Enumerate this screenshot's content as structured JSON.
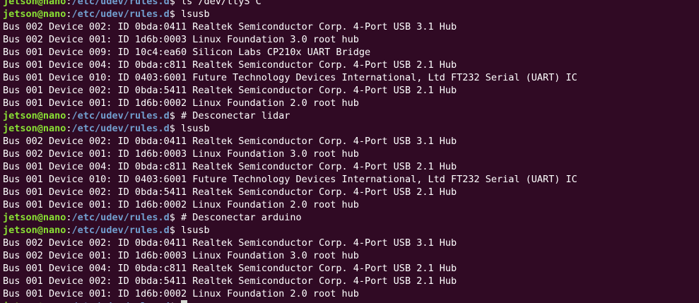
{
  "terminal": {
    "lines": [
      {
        "kind": "prompt",
        "user": "jetson@nano",
        "path": "/etc/udev/rules.d",
        "symbol": "$",
        "command": " ls /dev/ttyS C"
      },
      {
        "kind": "prompt",
        "user": "jetson@nano",
        "path": "/etc/udev/rules.d",
        "symbol": "$",
        "command": " lsusb"
      },
      {
        "kind": "output",
        "text": "Bus 002 Device 002: ID 0bda:0411 Realtek Semiconductor Corp. 4-Port USB 3.1 Hub"
      },
      {
        "kind": "output",
        "text": "Bus 002 Device 001: ID 1d6b:0003 Linux Foundation 3.0 root hub"
      },
      {
        "kind": "output",
        "text": "Bus 001 Device 009: ID 10c4:ea60 Silicon Labs CP210x UART Bridge"
      },
      {
        "kind": "output",
        "text": "Bus 001 Device 004: ID 0bda:c811 Realtek Semiconductor Corp. 4-Port USB 2.1 Hub"
      },
      {
        "kind": "output",
        "text": "Bus 001 Device 010: ID 0403:6001 Future Technology Devices International, Ltd FT232 Serial (UART) IC"
      },
      {
        "kind": "output",
        "text": "Bus 001 Device 002: ID 0bda:5411 Realtek Semiconductor Corp. 4-Port USB 2.1 Hub"
      },
      {
        "kind": "output",
        "text": "Bus 001 Device 001: ID 1d6b:0002 Linux Foundation 2.0 root hub"
      },
      {
        "kind": "prompt",
        "user": "jetson@nano",
        "path": "/etc/udev/rules.d",
        "symbol": "$",
        "command": " # Desconectar lidar"
      },
      {
        "kind": "prompt",
        "user": "jetson@nano",
        "path": "/etc/udev/rules.d",
        "symbol": "$",
        "command": " lsusb"
      },
      {
        "kind": "output",
        "text": "Bus 002 Device 002: ID 0bda:0411 Realtek Semiconductor Corp. 4-Port USB 3.1 Hub"
      },
      {
        "kind": "output",
        "text": "Bus 002 Device 001: ID 1d6b:0003 Linux Foundation 3.0 root hub"
      },
      {
        "kind": "output",
        "text": "Bus 001 Device 004: ID 0bda:c811 Realtek Semiconductor Corp. 4-Port USB 2.1 Hub"
      },
      {
        "kind": "output",
        "text": "Bus 001 Device 010: ID 0403:6001 Future Technology Devices International, Ltd FT232 Serial (UART) IC"
      },
      {
        "kind": "output",
        "text": "Bus 001 Device 002: ID 0bda:5411 Realtek Semiconductor Corp. 4-Port USB 2.1 Hub"
      },
      {
        "kind": "output",
        "text": "Bus 001 Device 001: ID 1d6b:0002 Linux Foundation 2.0 root hub"
      },
      {
        "kind": "prompt",
        "user": "jetson@nano",
        "path": "/etc/udev/rules.d",
        "symbol": "$",
        "command": " # Desconectar arduino"
      },
      {
        "kind": "prompt",
        "user": "jetson@nano",
        "path": "/etc/udev/rules.d",
        "symbol": "$",
        "command": " lsusb"
      },
      {
        "kind": "output",
        "text": "Bus 002 Device 002: ID 0bda:0411 Realtek Semiconductor Corp. 4-Port USB 3.1 Hub"
      },
      {
        "kind": "output",
        "text": "Bus 002 Device 001: ID 1d6b:0003 Linux Foundation 3.0 root hub"
      },
      {
        "kind": "output",
        "text": "Bus 001 Device 004: ID 0bda:c811 Realtek Semiconductor Corp. 4-Port USB 2.1 Hub"
      },
      {
        "kind": "output",
        "text": "Bus 001 Device 002: ID 0bda:5411 Realtek Semiconductor Corp. 4-Port USB 2.1 Hub"
      },
      {
        "kind": "output",
        "text": "Bus 001 Device 001: ID 1d6b:0002 Linux Foundation 2.0 root hub"
      },
      {
        "kind": "prompt",
        "user": "jetson@nano",
        "path": "/etc/udev/rules.d",
        "symbol": "$",
        "command": " ",
        "cursor": true
      }
    ]
  },
  "colors": {
    "background": "#300a24",
    "prompt_user": "#8ae234",
    "prompt_path": "#729fcf",
    "text": "#ffffff",
    "cursor": "#d3d7cf"
  }
}
